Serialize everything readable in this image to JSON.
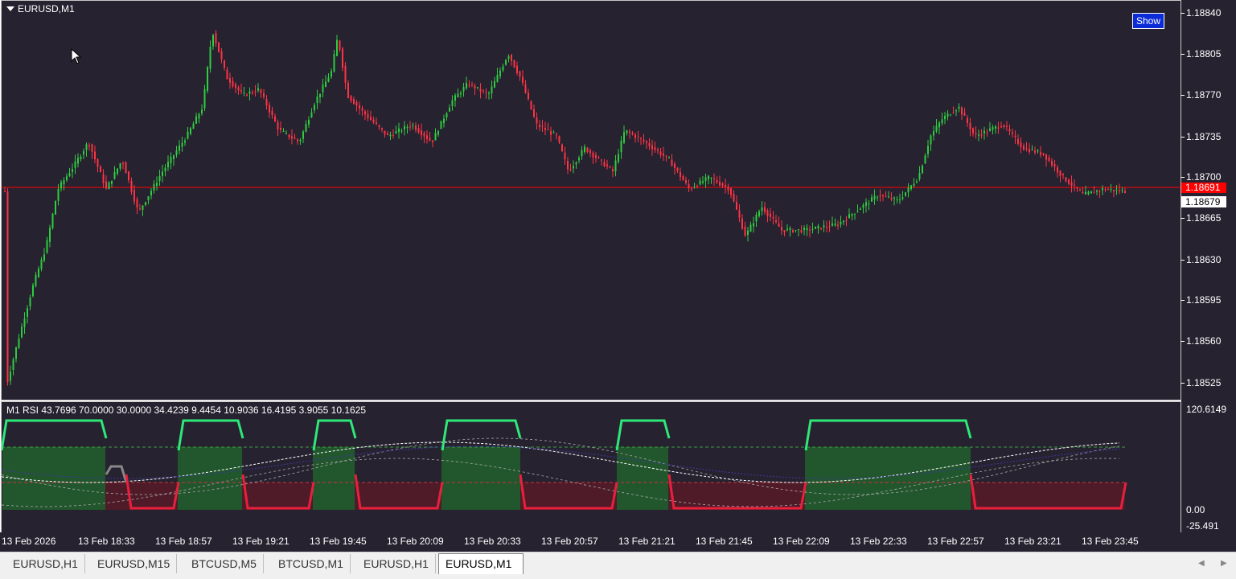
{
  "main_chart": {
    "symbol_title": "EURUSD,M1",
    "show_button": "Show",
    "current_price_label": "1.18691",
    "bid_price_label": "1.18679",
    "price_scale": [
      "1.18840",
      "1.18805",
      "1.18770",
      "1.18735",
      "1.18700",
      "1.18665",
      "1.18630",
      "1.18595",
      "1.18560",
      "1.18525"
    ]
  },
  "rsi_pane": {
    "label": "M1 RSI  43.7696 70.0000 30.0000 34.4239 9.4454 10.9036 16.4195 3.9055 10.1625",
    "scale_top": "120.6149",
    "scale_zero": "0.00",
    "scale_bottom": "-25.491"
  },
  "time_axis": [
    "13 Feb 2026",
    "13 Feb 18:33",
    "13 Feb 18:57",
    "13 Feb 19:21",
    "13 Feb 19:45",
    "13 Feb 20:09",
    "13 Feb 20:33",
    "13 Feb 20:57",
    "13 Feb 21:21",
    "13 Feb 21:45",
    "13 Feb 22:09",
    "13 Feb 22:33",
    "13 Feb 22:57",
    "13 Feb 23:21",
    "13 Feb 23:45"
  ],
  "tabs": [
    {
      "label": "EURUSD,H1"
    },
    {
      "label": "EURUSD,M15"
    },
    {
      "label": "BTCUSD,M5"
    },
    {
      "label": "BTCUSD,M1"
    },
    {
      "label": "EURUSD,H1"
    },
    {
      "label": "EURUSD,M1",
      "active": true
    }
  ],
  "colors": {
    "background": "#272230",
    "bull_candle": "#2ecc40",
    "bear_candle": "#ff3344",
    "price_line": "#ff0000",
    "rsi_high": "#2ee878",
    "rsi_low": "#e8203c",
    "show_button": "#0a2bd6"
  }
}
